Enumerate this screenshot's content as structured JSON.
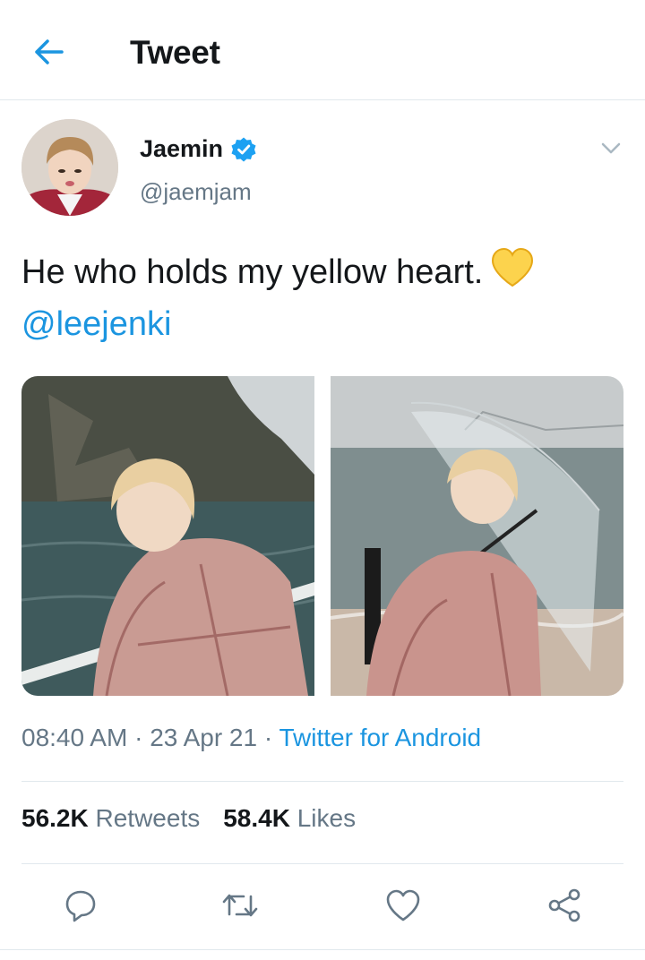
{
  "header": {
    "title": "Tweet",
    "back_icon": "arrow-left-icon"
  },
  "author": {
    "name": "Jaemin",
    "handle": "@jaemjam",
    "verified_icon": "verified-badge-icon",
    "menu_icon": "chevron-down-icon"
  },
  "tweet": {
    "text": "He who holds my yellow heart.",
    "emoji": "yellow-heart-icon",
    "mention": "@leejenki"
  },
  "media": {
    "photos": [
      {
        "subject": "person in plaid jacket by the sea"
      },
      {
        "subject": "person with clear umbrella on the beach"
      }
    ]
  },
  "meta": {
    "time": "08:40 AM",
    "separator": " · ",
    "date": "23 Apr 21",
    "source": "Twitter for Android"
  },
  "stats": {
    "retweets_count": "56.2K",
    "retweets_label": "Retweets",
    "likes_count": "58.4K",
    "likes_label": "Likes"
  },
  "actions": [
    "reply-icon",
    "retweet-icon",
    "like-icon",
    "share-icon"
  ],
  "colors": {
    "link": "#1b95e0",
    "muted": "#657786",
    "text": "#14171a",
    "heart": "#fcd34d"
  }
}
